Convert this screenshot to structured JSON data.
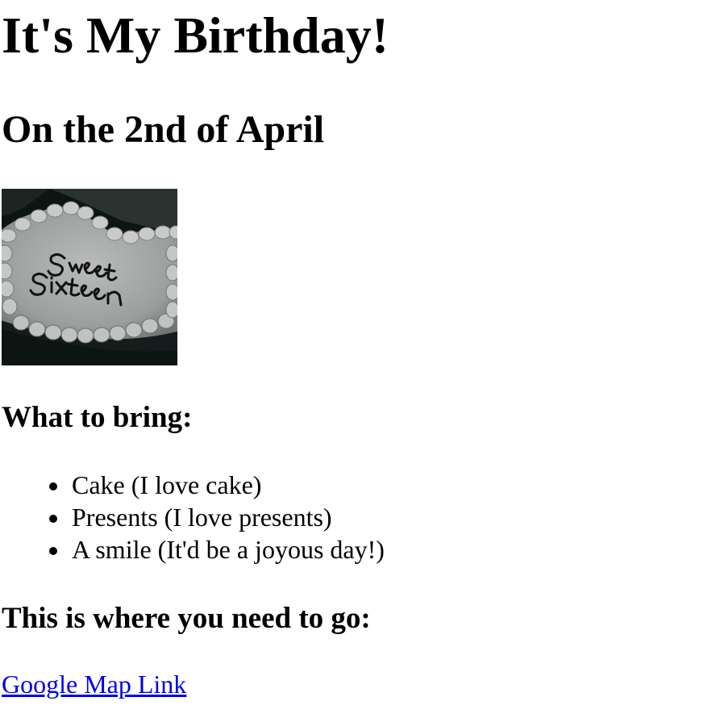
{
  "page": {
    "title": "It's My Birthday!",
    "subtitle": "On the 2nd of April",
    "image": {
      "caption_text": "Sweet Sixteen",
      "icon": "cake-photo"
    },
    "bring_heading": "What to bring:",
    "bring_items": [
      "Cake (I love cake)",
      "Presents (I love presents)",
      "A smile (It'd be a joyous day!)"
    ],
    "directions_heading": "This is where you need to go:",
    "map_link_label": "Google Map Link"
  },
  "colors": {
    "link": "#0000ee",
    "text": "#000000",
    "background": "#ffffff"
  }
}
